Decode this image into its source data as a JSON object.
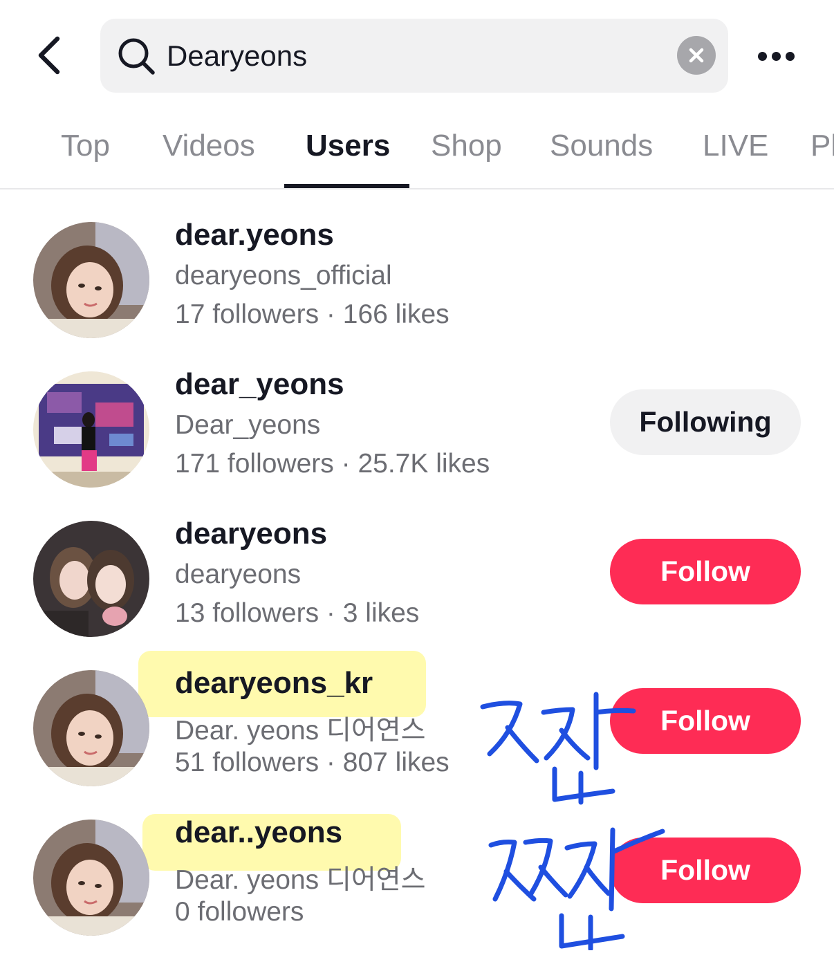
{
  "search": {
    "query": "Dearyeons"
  },
  "tabs": [
    {
      "label": "Top"
    },
    {
      "label": "Videos"
    },
    {
      "label": "Users"
    },
    {
      "label": "Shop"
    },
    {
      "label": "Sounds"
    },
    {
      "label": "LIVE"
    },
    {
      "label": "Pl"
    }
  ],
  "active_tab": "Users",
  "users": [
    {
      "username": "dear.yeons",
      "nickname": "dearyeons_official",
      "stats": "17 followers · 166 likes",
      "button": null,
      "highlighted": false
    },
    {
      "username": "dear_yeons",
      "nickname": "Dear_yeons",
      "stats": "171 followers · 25.7K likes",
      "button": "Following",
      "highlighted": false
    },
    {
      "username": "dearyeons",
      "nickname": "dearyeons",
      "stats": "13 followers · 3 likes",
      "button": "Follow",
      "highlighted": false
    },
    {
      "username": "dearyeons_kr",
      "nickname": "Dear. yeons 디어연스",
      "stats": "51 followers · 807 likes",
      "button": "Follow",
      "highlighted": true
    },
    {
      "username": "dear..yeons",
      "nickname": "Dear. yeons 디어연스",
      "stats": "0 followers",
      "button": "Follow",
      "highlighted": true
    }
  ],
  "annotations": {
    "handwritten_1": "짜잡",
    "handwritten_2": "짜잡",
    "handwriting_color": "#1f4fe0",
    "highlight_color": "#fff9a0"
  },
  "colors": {
    "primary": "#fe2c55",
    "text": "#161823",
    "secondary_text": "#6c6d73",
    "inactive_tab": "#8a8b91",
    "search_bg": "#f1f1f2"
  },
  "icons": {
    "back": "chevron-left-icon",
    "search": "search-icon",
    "clear": "close-icon",
    "more": "more-horizontal-icon"
  }
}
